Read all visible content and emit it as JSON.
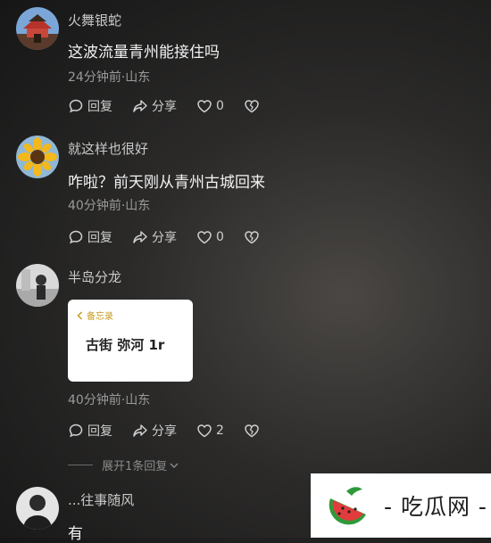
{
  "comments": [
    {
      "username": "火舞银蛇",
      "text": "这波流量青州能接住吗",
      "meta": "24分钟前·山东",
      "reply_label": "回复",
      "share_label": "分享",
      "likes": "0"
    },
    {
      "username": "就这样也很好",
      "text": "咋啦？前天刚从青州古城回来",
      "meta": "40分钟前·山东",
      "reply_label": "回复",
      "share_label": "分享",
      "likes": "0"
    },
    {
      "username": "半岛分龙",
      "memo": {
        "back_label": "备忘录",
        "text": "古街 弥河 1r"
      },
      "meta": "40分钟前·山东",
      "reply_label": "回复",
      "share_label": "分享",
      "likes": "2"
    },
    {
      "username": "...往事随风",
      "text": "有"
    }
  ],
  "expand_replies": "展开1条回复",
  "watermark": {
    "text": "- 吃瓜网 -"
  },
  "colors": {
    "accent": "#c89a1c",
    "watermelon_red": "#e23b3b",
    "watermelon_green": "#2e9a3a"
  }
}
